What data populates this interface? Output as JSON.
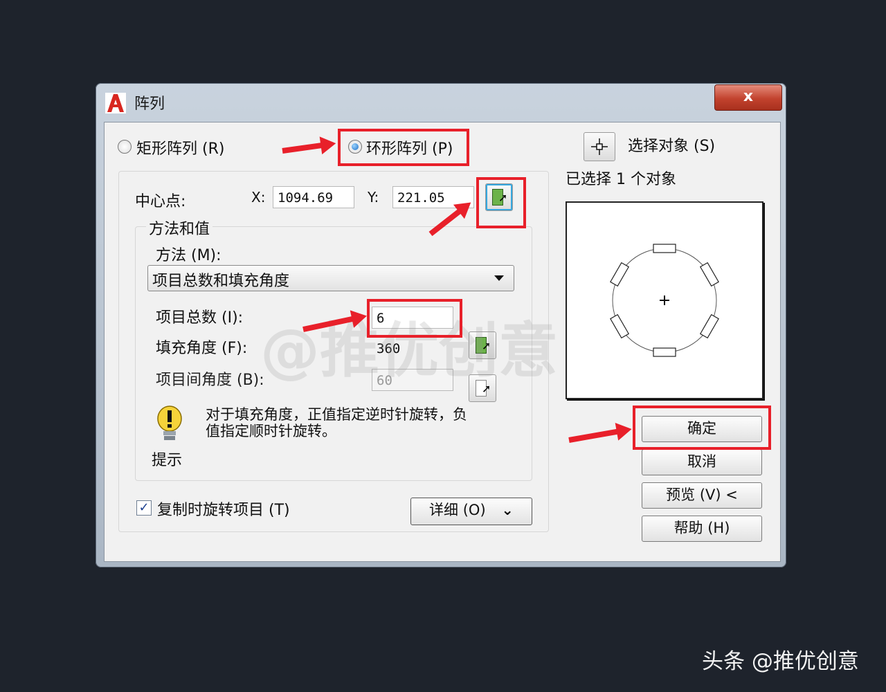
{
  "dialog": {
    "title": "阵列",
    "close_label": "x"
  },
  "array_type": {
    "rect_label": "矩形阵列 (R)",
    "polar_label": "环形阵列 (P)",
    "selected": "polar"
  },
  "center": {
    "label": "中心点:",
    "x_label": "X:",
    "x_value": "1094.69",
    "y_label": "Y:",
    "y_value": "221.05"
  },
  "method_group": {
    "title": "方法和值",
    "method_label": "方法 (M):",
    "method_value": "项目总数和填充角度",
    "total_label": "项目总数 (I):",
    "total_value": "6",
    "fill_label": "填充角度 (F):",
    "fill_value": "360",
    "between_label": "项目间角度 (B):",
    "between_value": "60"
  },
  "hint": {
    "text_line1": "对于填充角度，正值指定逆时针旋转，负",
    "text_line2": "值指定顺时针旋转。",
    "label": "提示"
  },
  "rotate_copy": {
    "label": "复制时旋转项目 (T)",
    "checked": true
  },
  "details_label": "详细 (O)",
  "select": {
    "button_label": "选择对象 (S)",
    "status": "已选择  1  个对象"
  },
  "buttons": {
    "ok": "确定",
    "cancel": "取消",
    "preview": "预览 (V) <",
    "help": "帮助 (H)"
  },
  "watermark": "@推优创意",
  "footer_watermark": "头条 @推优创意",
  "colors": {
    "background": "#1e232c",
    "highlight": "#e8202a",
    "radio_selected": "#1d6fc4"
  }
}
